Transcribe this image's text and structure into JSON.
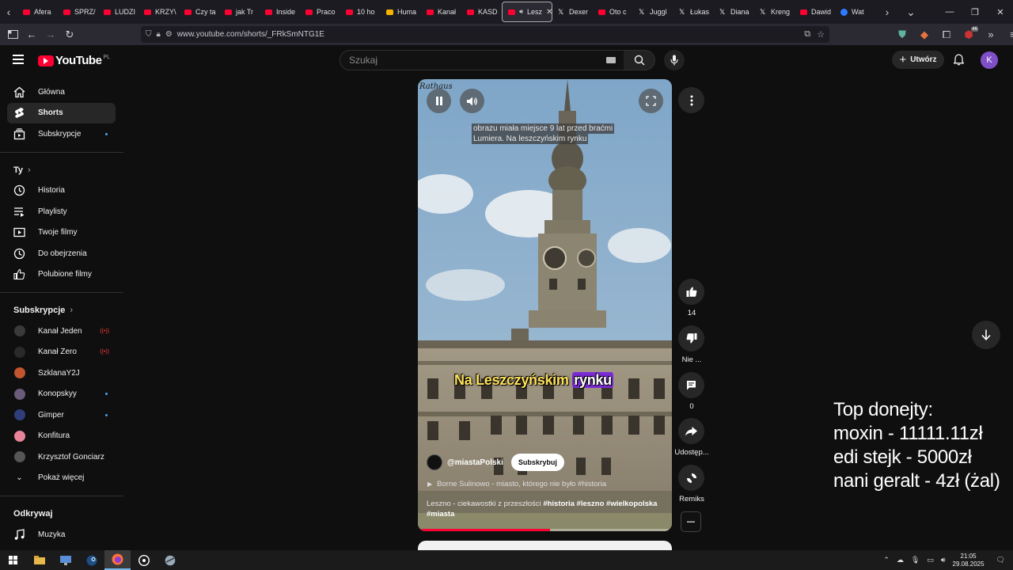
{
  "browser": {
    "tabs": [
      {
        "title": "Afera",
        "icon": "youtube"
      },
      {
        "title": "SPRZ/",
        "icon": "youtube"
      },
      {
        "title": "LUDZI",
        "icon": "youtube"
      },
      {
        "title": "KRZY\\",
        "icon": "youtube"
      },
      {
        "title": "Czy ta",
        "icon": "youtube"
      },
      {
        "title": "jak Tr",
        "icon": "youtube"
      },
      {
        "title": "Inside",
        "icon": "youtube"
      },
      {
        "title": "Praco",
        "icon": "youtube"
      },
      {
        "title": "10 ho",
        "icon": "youtube"
      },
      {
        "title": "Huma",
        "icon": "bookmark-star"
      },
      {
        "title": "Kanał",
        "icon": "youtube"
      },
      {
        "title": "KASD",
        "icon": "youtube"
      },
      {
        "title": "Lesz",
        "icon": "youtube",
        "active": true
      },
      {
        "title": "Dexer",
        "icon": "x"
      },
      {
        "title": "Oto c",
        "icon": "youtube"
      },
      {
        "title": "Juggl",
        "icon": "x"
      },
      {
        "title": "Łukas",
        "icon": "x"
      },
      {
        "title": "Diana",
        "icon": "x"
      },
      {
        "title": "Kreng",
        "icon": "x"
      },
      {
        "title": "Dawid",
        "icon": "youtube"
      },
      {
        "title": "Wat",
        "icon": "generic"
      }
    ],
    "url": "www.youtube.com/shorts/_FRkSmNTG1E",
    "extension_badge": "46"
  },
  "header": {
    "logo_text": "YouTube",
    "logo_country": "PL",
    "search_placeholder": "Szukaj",
    "create_label": "Utwórz",
    "avatar_letter": "K"
  },
  "sidebar": {
    "main": [
      {
        "label": "Główna",
        "icon": "home-icon"
      },
      {
        "label": "Shorts",
        "icon": "shorts-icon",
        "active": true
      },
      {
        "label": "Subskrypcje",
        "icon": "subscriptions-icon",
        "dot": true
      }
    ],
    "you_heading": "Ty",
    "you": [
      {
        "label": "Historia",
        "icon": "history-icon"
      },
      {
        "label": "Playlisty",
        "icon": "playlists-icon"
      },
      {
        "label": "Twoje filmy",
        "icon": "your-videos-icon"
      },
      {
        "label": "Do obejrzenia",
        "icon": "watch-later-icon"
      },
      {
        "label": "Polubione filmy",
        "icon": "liked-icon"
      }
    ],
    "subs_heading": "Subskrypcje",
    "subscriptions": [
      {
        "label": "Kanał Jeden",
        "status": "live",
        "color": "#3a3a3a"
      },
      {
        "label": "Kanał Zero",
        "status": "live",
        "color": "#2a2a2a"
      },
      {
        "label": "SzklanaY2J",
        "status": "",
        "color": "#c0552e"
      },
      {
        "label": "Konopskyy",
        "status": "dot",
        "color": "#6b5a7a"
      },
      {
        "label": "Gimper",
        "status": "dot",
        "color": "#2f3e7a"
      },
      {
        "label": "Konfitura",
        "status": "",
        "color": "#e8849a"
      },
      {
        "label": "Krzysztof Gonciarz",
        "status": "",
        "color": "#555555"
      }
    ],
    "show_more": "Pokaż więcej",
    "explore_heading": "Odkrywaj",
    "explore": [
      {
        "label": "Muzyka",
        "icon": "music-icon"
      },
      {
        "label": "Filmy",
        "icon": "movies-icon"
      }
    ]
  },
  "short": {
    "caption_lines": [
      "obrazu miała miejsce 9 lat przed braćmi",
      "Lumiera. Na leszczyńskim rynku"
    ],
    "burned_subtitle_part1": "Na Leszczyńskim ",
    "burned_subtitle_part2": "rynku",
    "channel_handle": "@miastaPolski",
    "subscribe_label": "Subskrybuj",
    "linked_video": "Borne Sulinowo - miasto, którego nie było  #historia",
    "description_text": "Leszno - ciekawostki z przeszłości ",
    "description_tags": "#historia #leszno #wielkopolska #miasta",
    "progress": 0.52,
    "image_label": "Rathaus"
  },
  "actions": {
    "likes": "14",
    "dislike_label": "Nie ...",
    "comments": "0",
    "share_label": "Udostęp...",
    "remix_label": "Remiks"
  },
  "donate_overlay": {
    "title": "Top donejty:",
    "lines": [
      "moxin - 11111.11zł",
      "edi stejk - 5000zł",
      "nani geralt - 4zł (żal)"
    ]
  },
  "taskbar": {
    "time": "21:05",
    "date": "29.08.2025"
  },
  "colors": {
    "accent": "#ff0033",
    "background": "#0f0f0f",
    "subtitle_highlight": "#7b2bd6",
    "subtitle_text": "#ffe15a"
  }
}
